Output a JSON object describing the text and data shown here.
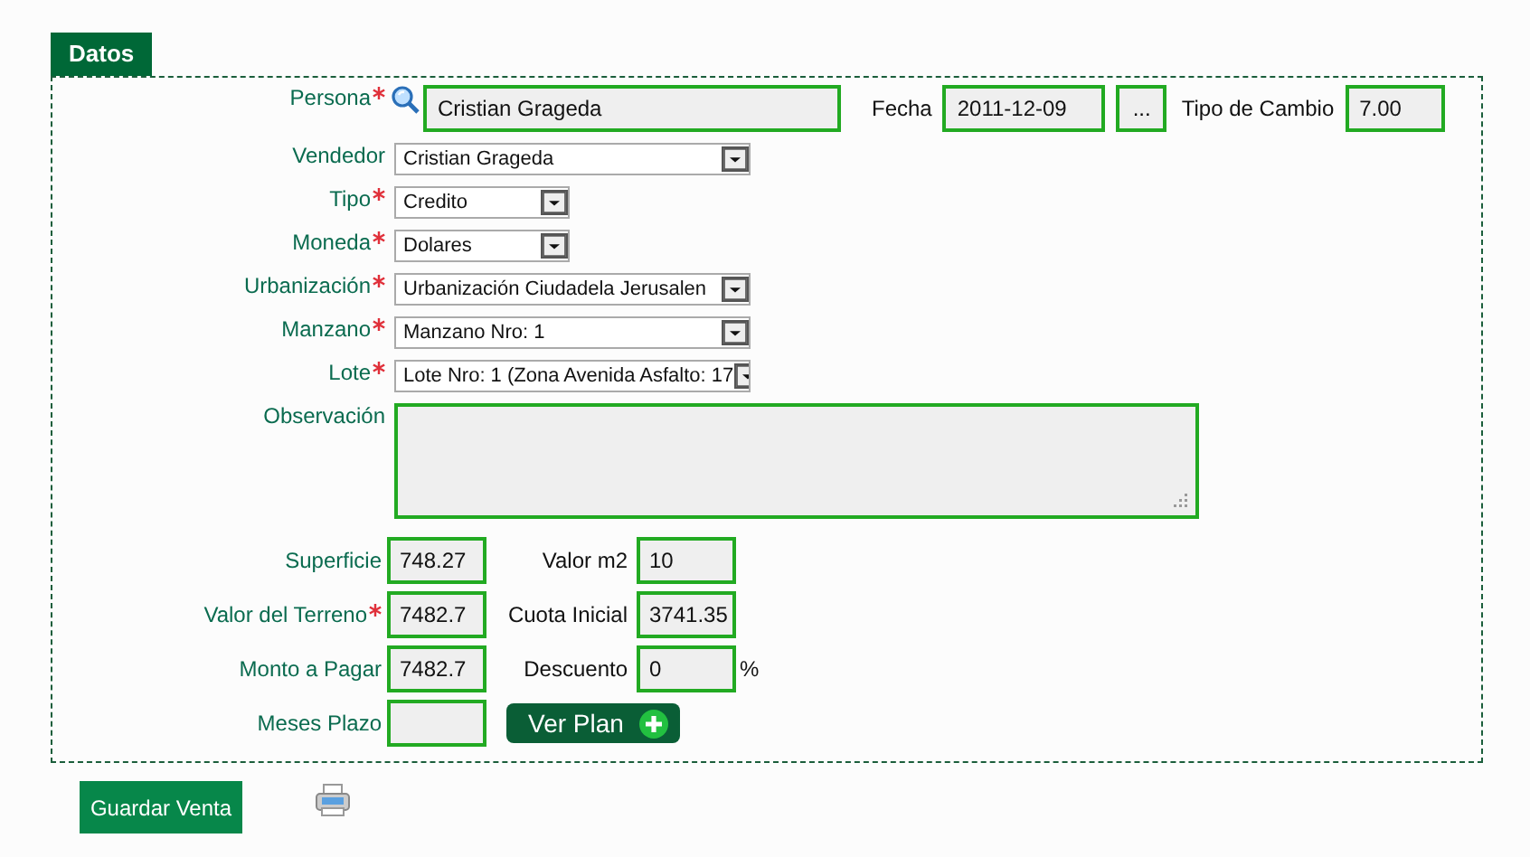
{
  "tab": {
    "label": "Datos",
    "selected": true
  },
  "persona": {
    "label": "Persona",
    "required": true,
    "value": "Cristian Grageda"
  },
  "fecha": {
    "label": "Fecha",
    "value": "2011-12-09",
    "button": "..."
  },
  "tipo_cambio": {
    "label": "Tipo de Cambio",
    "value": "7.00"
  },
  "fields": [
    {
      "kind": "select",
      "label": "Vendedor",
      "required": false,
      "value": "Cristian Grageda"
    },
    {
      "kind": "short_select",
      "label": "Tipo",
      "required": true,
      "value": "Credito"
    },
    {
      "kind": "short_select",
      "label": "Moneda",
      "required": true,
      "value": "Dolares"
    },
    {
      "kind": "select",
      "label": "Urbanización",
      "required": true,
      "value": "Urbanización Ciudadela Jerusalen"
    },
    {
      "kind": "select",
      "label": "Manzano",
      "required": true,
      "value": "Manzano Nro: 1"
    },
    {
      "kind": "select",
      "label": "Lote",
      "required": true,
      "value": "Lote Nro: 1 (Zona Avenida Asfalto: 17"
    },
    {
      "kind": "textarea",
      "label": "Observación",
      "required": false
    }
  ],
  "amounts": [
    {
      "label": "Superficie",
      "required": false,
      "value": "748.27",
      "second": {
        "label": "Valor m2",
        "value": "10"
      }
    },
    {
      "label": "Valor del Terreno",
      "required": true,
      "value": "7482.7",
      "second": {
        "label": "Cuota Inicial",
        "value": "3741.35"
      }
    },
    {
      "label": "Monto a Pagar",
      "required": false,
      "value": "7482.7",
      "second": {
        "label": "Descuento",
        "value": "0",
        "suffix": "%"
      }
    },
    {
      "label": "Meses Plazo",
      "required": false,
      "button": "Ver Plan"
    }
  ],
  "save_button": "Guardar Venta"
}
